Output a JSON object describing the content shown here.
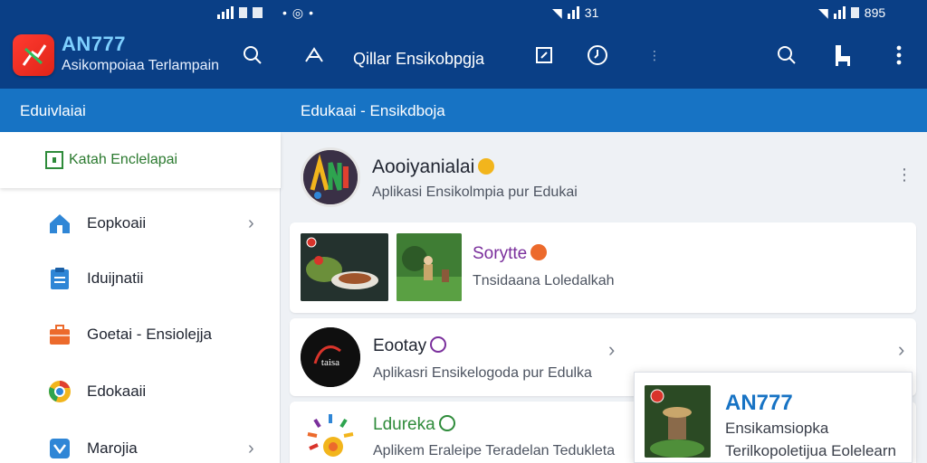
{
  "status": {
    "left_time": "",
    "center_time": "31",
    "right_time": "895"
  },
  "header": {
    "brand_title": "AN777",
    "brand_subtitle": "Asikompoiaa Terlampain",
    "app_title": "Qillar Ensikobpgja",
    "icons": [
      "search-icon",
      "arrow-up-icon",
      "edit-icon",
      "clock-icon",
      "search-icon",
      "chair-icon",
      "more-vert-icon"
    ]
  },
  "subbar": {
    "left_label": "Eduivlaiai",
    "right_label": "Edukaai - Ensikdboja"
  },
  "sidebar": {
    "head_label": "Katah Enclelapai",
    "items": [
      {
        "label": "Eopkoaii",
        "icon": "home-icon",
        "color": "#2f86d6",
        "chevron": true
      },
      {
        "label": "Iduijnatii",
        "icon": "clipboard-icon",
        "color": "#2f86d6",
        "chevron": false
      },
      {
        "label": "Goetai - Ensiolejja",
        "icon": "briefcase-icon",
        "color": "#ec6a2c",
        "chevron": false
      },
      {
        "label": "Edokaaii",
        "icon": "chrome-icon",
        "color": "#f2b51c",
        "chevron": false
      },
      {
        "label": "Marojia",
        "icon": "shopping-bag-icon",
        "color": "#2f86d6",
        "chevron": true
      }
    ]
  },
  "feed": {
    "profile": {
      "name": "Aooiyanialai",
      "description": "Aplikasi Ensikolmpia pur Edukai"
    },
    "story": {
      "title": "Sorytte",
      "description": "Tnsidaana Loledalkah"
    },
    "post1": {
      "title": "Eootay",
      "description": "Aplikasri Ensikelogoda pur Edulka",
      "avatar_text": "taisa"
    },
    "post2": {
      "title": "Ldureka",
      "description": "Aplikem Eraleipe Teradelan Tedukleta"
    }
  },
  "popup": {
    "title": "AN777",
    "line1": "Ensikamsiopka",
    "line2": "Terilkopoletijua Eolelearn"
  },
  "colors": {
    "appbar": "#0a3f86",
    "subbar": "#1773c4",
    "accent": "#7fd0ff",
    "green": "#2e8b3a",
    "purple": "#7a2f9c"
  }
}
